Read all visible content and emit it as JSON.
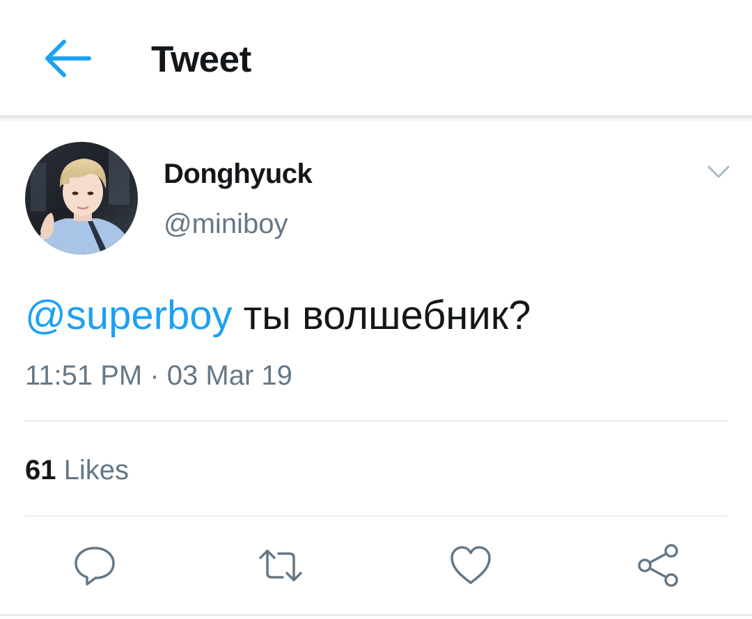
{
  "header": {
    "title": "Tweet",
    "back_icon": "arrow-left-icon"
  },
  "tweet": {
    "author": {
      "display_name": "Donghyuck",
      "handle": "@miniboy"
    },
    "mention": "@superboy",
    "text": " ты волшебник?",
    "timestamp": "11:51 PM · 03 Mar 19",
    "likes": {
      "count": "61",
      "label": "Likes"
    }
  },
  "actions": {
    "reply_icon": "reply-icon",
    "retweet_icon": "retweet-icon",
    "like_icon": "heart-icon",
    "share_icon": "share-icon"
  },
  "colors": {
    "accent": "#1da1f2",
    "text": "#14171a",
    "secondary": "#657786",
    "divider": "#e6ecf0"
  }
}
